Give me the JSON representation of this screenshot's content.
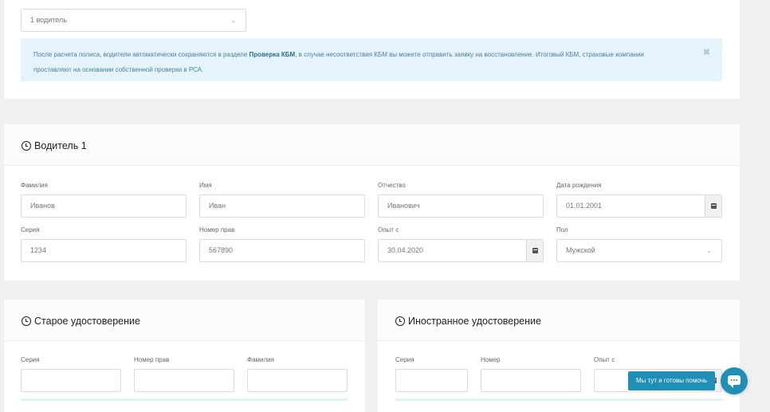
{
  "drivers_select": {
    "value": "1 водитель"
  },
  "alert": {
    "text_before": "После расчета полиса, водители автоматически сохраняются в разделе ",
    "link": "Проверка КБМ",
    "text_after": ", в случае несоответствия КБМ вы можете отправить заявку на восстановление. Итоговый КБМ, страховые компании проставляют на основании собственной проверки в РСА.",
    "close": "✖"
  },
  "driver": {
    "title": "Водитель 1",
    "fields": {
      "last_name": {
        "label": "Фамилия",
        "value": "Иванов"
      },
      "first_name": {
        "label": "Имя",
        "value": "Иван"
      },
      "patronymic": {
        "label": "Отчество",
        "value": "Иванович"
      },
      "birth_date": {
        "label": "Дата рождения",
        "value": "01.01.2001"
      },
      "series": {
        "label": "Серия",
        "value": "1234"
      },
      "license_number": {
        "label": "Номер прав",
        "value": "567890"
      },
      "experience": {
        "label": "Опыт с",
        "value": "30.04.2020"
      },
      "gender": {
        "label": "Пол",
        "value": "Мужской"
      }
    }
  },
  "old_license": {
    "title": "Старое удостоверение",
    "labels": {
      "series": "Серия",
      "number": "Номер прав",
      "last_name": "Фамилия"
    }
  },
  "foreign_license": {
    "title": "Иностранное удостоверение",
    "labels": {
      "series": "Серия",
      "number": "Номер",
      "experience": "Опыт с"
    }
  },
  "chat": {
    "label": "Мы тут и готовы помочь"
  }
}
